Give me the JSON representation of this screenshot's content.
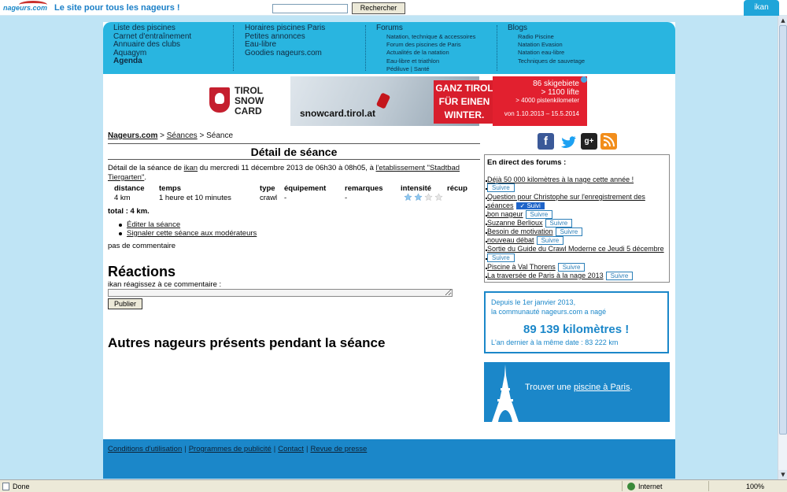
{
  "header": {
    "logo_text": "nageurs.com",
    "tagline": "Le site pour tous les nageurs !",
    "search_button": "Rechercher",
    "user": "ikan"
  },
  "nav": {
    "col1": [
      "Liste des piscines",
      "Carnet d'entraînement",
      "Annuaire des clubs",
      "Aquagym",
      "Agenda"
    ],
    "col2": [
      "Horaires piscines Paris",
      "Petites annonces",
      "Eau-libre",
      "Goodies nageurs.com"
    ],
    "forums_title": "Forums",
    "forums": [
      "Natation, technique & accessoires",
      "Forum des piscines de Paris",
      "Actualités de la natation",
      "Eau-libre et triathlon",
      "Pédiluve | Santé"
    ],
    "blogs_title": "Blogs",
    "blogs": [
      "Radio Piscine",
      "Natation Evasion",
      "Natation eau-libre",
      "Techniques de sauvetage"
    ]
  },
  "ad": {
    "brand_l1": "TIROL",
    "brand_l2": "SNOW",
    "brand_l3": "CARD",
    "url": "snowcard.tirol.at",
    "slogan_l1": "GANZ TIROL",
    "slogan_l2": "FÜR EINEN",
    "slogan_l3": "WINTER.",
    "stat1": "86 skigebiete",
    "stat2": "> 1100 lifte",
    "stat3": "> 4000 pistenkilometer",
    "dates": "von 1.10.2013 – 15.5.2014"
  },
  "breadcrumb": {
    "home": "Nageurs.com",
    "sep": ">",
    "level1": "Séances",
    "current": "Séance"
  },
  "page_title": "Détail de séance",
  "detail": {
    "prefix": "Détail de la séance de",
    "user": "ikan",
    "middle": "du mercredi 11 décembre 2013 de 06h30 à 08h05, à",
    "place": "l'etablissement \"Stadtbad Tiergarten\"",
    "suffix": "."
  },
  "session": {
    "headers": {
      "distance": "distance",
      "temps": "temps",
      "type": "type",
      "equipement": "équipement",
      "remarques": "remarques",
      "intensite": "intensité",
      "recup": "récup"
    },
    "row": {
      "distance": "4 km",
      "temps": "1 heure et 10 minutes",
      "type": "crawl",
      "equipement": "-",
      "remarques": "-",
      "intensite_stars": 2,
      "intensite_max": 4
    }
  },
  "total": "total : 4 km.",
  "actions": [
    "Éditer la séance",
    "Signaler cette séance aux modérateurs"
  ],
  "no_comment": "pas de commentaire",
  "reactions": {
    "title": "Réactions",
    "prompt": "ikan réagissez à ce commentaire :",
    "publish": "Publier"
  },
  "others_title": "Autres nageurs présents pendant la séance",
  "forum_live": {
    "title": "En direct des forums :",
    "follow": "Suivre",
    "followed": "✓ Suivi",
    "items": [
      "Déjà 50 000 kilomètres à la nage cette année !",
      "Question pour Christophe sur l'enregistrement des",
      "séances",
      "bon nageur",
      "Suzanne Berlioux",
      "Besoin de motivation",
      "nouveau débat",
      "Sortie du Guide du Crawl Moderne ce Jeudi 5 décembre",
      "Piscine à Val Thorens",
      "La traversée de Paris à la nage 2013"
    ]
  },
  "stats": {
    "line1": "Depuis le 1er janvier 2013,",
    "line2": "la communauté nageurs.com a nagé",
    "km": "89 139 kilomètres !",
    "line4": "L'an dernier à la même date : 83 222 km"
  },
  "paris": {
    "prefix": "Trouver une",
    "link": "piscine à Paris",
    "suffix": "."
  },
  "footer": {
    "links": [
      "Conditions d'utilisation",
      "Programmes de publicité",
      "Contact",
      "Revue de presse"
    ],
    "pipe": "|"
  },
  "social": {
    "facebook": "f",
    "googleplus": "g+"
  },
  "statusbar": {
    "done": "Done",
    "zone": "Internet",
    "zoom": "100%"
  }
}
